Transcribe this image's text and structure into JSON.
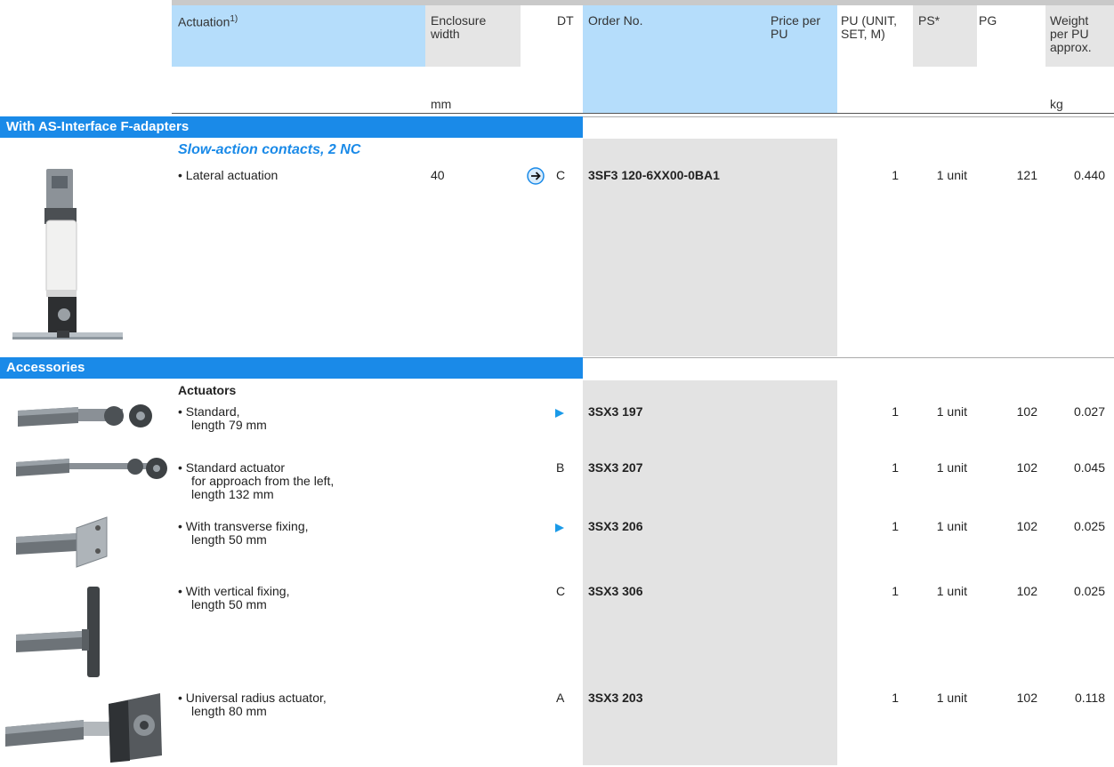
{
  "header": {
    "actuation": "Actuation",
    "actuation_sup": "1)",
    "enclosure": "Enclosure width",
    "dt": "DT",
    "order_no": "Order No.",
    "price": "Price per PU",
    "pu": "PU (UNIT, SET, M)",
    "ps": "PS*",
    "pg": "PG",
    "weight": "Weight per PU approx.",
    "unit_mm": "mm",
    "unit_kg": "kg"
  },
  "sections": {
    "asi": "With AS-Interface F-adapters",
    "accessories": "Accessories"
  },
  "asi_group": {
    "subhead": "Slow-action contacts, 2 NC",
    "row": {
      "desc": "• Lateral actuation",
      "width": "40",
      "dt": "C",
      "order": "3SF3 120-6XX00-0BA1",
      "pu": "1",
      "ps": "1 unit",
      "pg": "121",
      "weight": "0.440"
    }
  },
  "accessories": {
    "subhead": "Actuators",
    "rows": [
      {
        "desc1": "• Standard,",
        "desc2": "length 79 mm",
        "desc3": "",
        "dt": "",
        "order": "3SX3 197",
        "pu": "1",
        "ps": "1 unit",
        "pg": "102",
        "weight": "0.027"
      },
      {
        "desc1": "• Standard actuator",
        "desc2": "for approach from the left,",
        "desc3": "length 132 mm",
        "dt": "B",
        "order": "3SX3 207",
        "pu": "1",
        "ps": "1 unit",
        "pg": "102",
        "weight": "0.045"
      },
      {
        "desc1": "• With transverse fixing,",
        "desc2": "length 50 mm",
        "desc3": "",
        "dt": "",
        "order": "3SX3 206",
        "pu": "1",
        "ps": "1 unit",
        "pg": "102",
        "weight": "0.025"
      },
      {
        "desc1": "• With vertical fixing,",
        "desc2": "length 50 mm",
        "desc3": "",
        "dt": "C",
        "order": "3SX3 306",
        "pu": "1",
        "ps": "1 unit",
        "pg": "102",
        "weight": "0.025"
      },
      {
        "desc1": "• Universal radius actuator,",
        "desc2": "length 80 mm",
        "desc3": "",
        "dt": "A",
        "order": "3SX3 203",
        "pu": "1",
        "ps": "1 unit",
        "pg": "102",
        "weight": "0.118"
      }
    ]
  },
  "colors": {
    "accent": "#1a8ae8",
    "header_blue": "#b5ddfb",
    "header_grey": "#e5e5e5",
    "order_bg": "#e3e3e3"
  },
  "icons": {
    "arrow_circle": "circled-right-arrow-icon",
    "triangle": "right-triangle-marker-icon"
  }
}
